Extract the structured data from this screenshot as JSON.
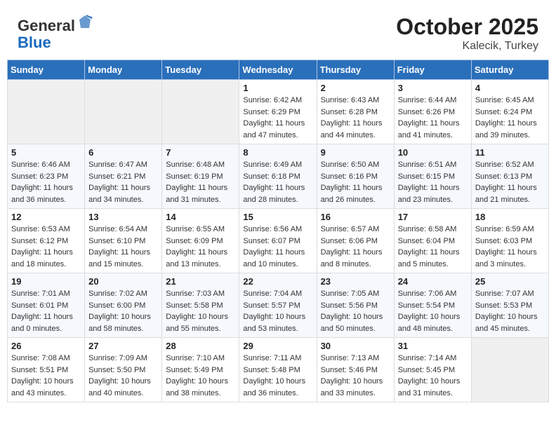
{
  "header": {
    "logo_line1": "General",
    "logo_line2": "Blue",
    "month": "October 2025",
    "location": "Kalecik, Turkey"
  },
  "weekdays": [
    "Sunday",
    "Monday",
    "Tuesday",
    "Wednesday",
    "Thursday",
    "Friday",
    "Saturday"
  ],
  "weeks": [
    [
      {
        "day": "",
        "sunrise": "",
        "sunset": "",
        "daylight": ""
      },
      {
        "day": "",
        "sunrise": "",
        "sunset": "",
        "daylight": ""
      },
      {
        "day": "",
        "sunrise": "",
        "sunset": "",
        "daylight": ""
      },
      {
        "day": "1",
        "sunrise": "Sunrise: 6:42 AM",
        "sunset": "Sunset: 6:29 PM",
        "daylight": "Daylight: 11 hours and 47 minutes."
      },
      {
        "day": "2",
        "sunrise": "Sunrise: 6:43 AM",
        "sunset": "Sunset: 6:28 PM",
        "daylight": "Daylight: 11 hours and 44 minutes."
      },
      {
        "day": "3",
        "sunrise": "Sunrise: 6:44 AM",
        "sunset": "Sunset: 6:26 PM",
        "daylight": "Daylight: 11 hours and 41 minutes."
      },
      {
        "day": "4",
        "sunrise": "Sunrise: 6:45 AM",
        "sunset": "Sunset: 6:24 PM",
        "daylight": "Daylight: 11 hours and 39 minutes."
      }
    ],
    [
      {
        "day": "5",
        "sunrise": "Sunrise: 6:46 AM",
        "sunset": "Sunset: 6:23 PM",
        "daylight": "Daylight: 11 hours and 36 minutes."
      },
      {
        "day": "6",
        "sunrise": "Sunrise: 6:47 AM",
        "sunset": "Sunset: 6:21 PM",
        "daylight": "Daylight: 11 hours and 34 minutes."
      },
      {
        "day": "7",
        "sunrise": "Sunrise: 6:48 AM",
        "sunset": "Sunset: 6:19 PM",
        "daylight": "Daylight: 11 hours and 31 minutes."
      },
      {
        "day": "8",
        "sunrise": "Sunrise: 6:49 AM",
        "sunset": "Sunset: 6:18 PM",
        "daylight": "Daylight: 11 hours and 28 minutes."
      },
      {
        "day": "9",
        "sunrise": "Sunrise: 6:50 AM",
        "sunset": "Sunset: 6:16 PM",
        "daylight": "Daylight: 11 hours and 26 minutes."
      },
      {
        "day": "10",
        "sunrise": "Sunrise: 6:51 AM",
        "sunset": "Sunset: 6:15 PM",
        "daylight": "Daylight: 11 hours and 23 minutes."
      },
      {
        "day": "11",
        "sunrise": "Sunrise: 6:52 AM",
        "sunset": "Sunset: 6:13 PM",
        "daylight": "Daylight: 11 hours and 21 minutes."
      }
    ],
    [
      {
        "day": "12",
        "sunrise": "Sunrise: 6:53 AM",
        "sunset": "Sunset: 6:12 PM",
        "daylight": "Daylight: 11 hours and 18 minutes."
      },
      {
        "day": "13",
        "sunrise": "Sunrise: 6:54 AM",
        "sunset": "Sunset: 6:10 PM",
        "daylight": "Daylight: 11 hours and 15 minutes."
      },
      {
        "day": "14",
        "sunrise": "Sunrise: 6:55 AM",
        "sunset": "Sunset: 6:09 PM",
        "daylight": "Daylight: 11 hours and 13 minutes."
      },
      {
        "day": "15",
        "sunrise": "Sunrise: 6:56 AM",
        "sunset": "Sunset: 6:07 PM",
        "daylight": "Daylight: 11 hours and 10 minutes."
      },
      {
        "day": "16",
        "sunrise": "Sunrise: 6:57 AM",
        "sunset": "Sunset: 6:06 PM",
        "daylight": "Daylight: 11 hours and 8 minutes."
      },
      {
        "day": "17",
        "sunrise": "Sunrise: 6:58 AM",
        "sunset": "Sunset: 6:04 PM",
        "daylight": "Daylight: 11 hours and 5 minutes."
      },
      {
        "day": "18",
        "sunrise": "Sunrise: 6:59 AM",
        "sunset": "Sunset: 6:03 PM",
        "daylight": "Daylight: 11 hours and 3 minutes."
      }
    ],
    [
      {
        "day": "19",
        "sunrise": "Sunrise: 7:01 AM",
        "sunset": "Sunset: 6:01 PM",
        "daylight": "Daylight: 11 hours and 0 minutes."
      },
      {
        "day": "20",
        "sunrise": "Sunrise: 7:02 AM",
        "sunset": "Sunset: 6:00 PM",
        "daylight": "Daylight: 10 hours and 58 minutes."
      },
      {
        "day": "21",
        "sunrise": "Sunrise: 7:03 AM",
        "sunset": "Sunset: 5:58 PM",
        "daylight": "Daylight: 10 hours and 55 minutes."
      },
      {
        "day": "22",
        "sunrise": "Sunrise: 7:04 AM",
        "sunset": "Sunset: 5:57 PM",
        "daylight": "Daylight: 10 hours and 53 minutes."
      },
      {
        "day": "23",
        "sunrise": "Sunrise: 7:05 AM",
        "sunset": "Sunset: 5:56 PM",
        "daylight": "Daylight: 10 hours and 50 minutes."
      },
      {
        "day": "24",
        "sunrise": "Sunrise: 7:06 AM",
        "sunset": "Sunset: 5:54 PM",
        "daylight": "Daylight: 10 hours and 48 minutes."
      },
      {
        "day": "25",
        "sunrise": "Sunrise: 7:07 AM",
        "sunset": "Sunset: 5:53 PM",
        "daylight": "Daylight: 10 hours and 45 minutes."
      }
    ],
    [
      {
        "day": "26",
        "sunrise": "Sunrise: 7:08 AM",
        "sunset": "Sunset: 5:51 PM",
        "daylight": "Daylight: 10 hours and 43 minutes."
      },
      {
        "day": "27",
        "sunrise": "Sunrise: 7:09 AM",
        "sunset": "Sunset: 5:50 PM",
        "daylight": "Daylight: 10 hours and 40 minutes."
      },
      {
        "day": "28",
        "sunrise": "Sunrise: 7:10 AM",
        "sunset": "Sunset: 5:49 PM",
        "daylight": "Daylight: 10 hours and 38 minutes."
      },
      {
        "day": "29",
        "sunrise": "Sunrise: 7:11 AM",
        "sunset": "Sunset: 5:48 PM",
        "daylight": "Daylight: 10 hours and 36 minutes."
      },
      {
        "day": "30",
        "sunrise": "Sunrise: 7:13 AM",
        "sunset": "Sunset: 5:46 PM",
        "daylight": "Daylight: 10 hours and 33 minutes."
      },
      {
        "day": "31",
        "sunrise": "Sunrise: 7:14 AM",
        "sunset": "Sunset: 5:45 PM",
        "daylight": "Daylight: 10 hours and 31 minutes."
      },
      {
        "day": "",
        "sunrise": "",
        "sunset": "",
        "daylight": ""
      }
    ]
  ]
}
